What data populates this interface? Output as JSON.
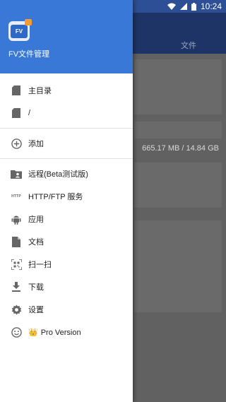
{
  "status_bar": {
    "time": "10:24"
  },
  "background": {
    "tab_label": "文件",
    "storage_text": "665.17 MB  /  14.84 GB",
    "storage_fraction": 0.045
  },
  "drawer": {
    "title": "FV文件管理",
    "logo_text": "FV",
    "items": [
      {
        "label": "主目录",
        "icon": "sd-card-icon"
      },
      {
        "label": "/",
        "icon": "sd-card-icon"
      },
      {
        "label": "添加",
        "icon": "add-circle-icon"
      },
      {
        "label": "远程(Beta测试版)",
        "icon": "remote-folder-icon"
      },
      {
        "label": "HTTP/FTP 服务",
        "icon": "http-icon",
        "icon_text": "HTTP"
      },
      {
        "label": "应用",
        "icon": "android-icon"
      },
      {
        "label": "文档",
        "icon": "document-icon"
      },
      {
        "label": "扫一扫",
        "icon": "scan-icon"
      },
      {
        "label": "下载",
        "icon": "download-icon"
      },
      {
        "label": "设置",
        "icon": "settings-icon"
      },
      {
        "label": "Pro Version",
        "icon": "smiley-icon"
      }
    ]
  }
}
